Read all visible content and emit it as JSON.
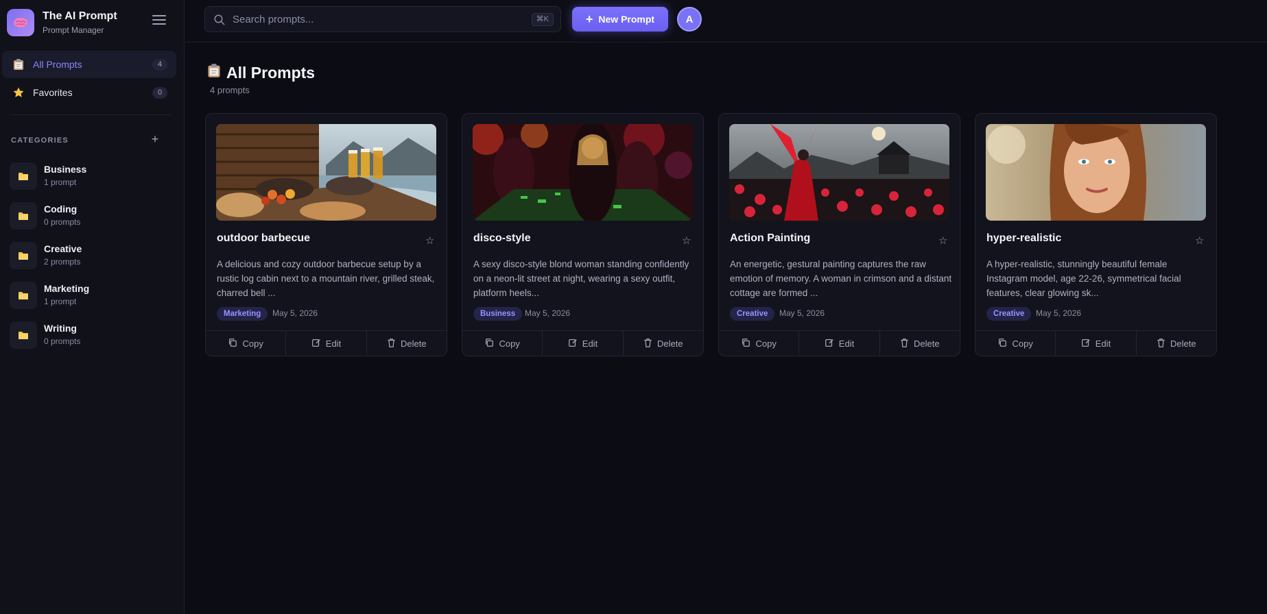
{
  "app": {
    "title": "The AI Prompt",
    "subtitle": "Prompt Manager"
  },
  "nav": [
    {
      "label": "All Prompts",
      "count": "4",
      "icon": "clipboard-icon",
      "active": true
    },
    {
      "label": "Favorites",
      "count": "0",
      "icon": "star-icon",
      "active": false
    }
  ],
  "categories": {
    "heading": "CATEGORIES",
    "items": [
      {
        "name": "Business",
        "count": "1 prompt"
      },
      {
        "name": "Coding",
        "count": "0 prompts"
      },
      {
        "name": "Creative",
        "count": "2 prompts"
      },
      {
        "name": "Marketing",
        "count": "1 prompt"
      },
      {
        "name": "Writing",
        "count": "0 prompts"
      }
    ]
  },
  "search": {
    "placeholder": "Search prompts...",
    "shortcut": "⌘K"
  },
  "toolbar": {
    "new_label": "New Prompt",
    "avatar_initial": "A"
  },
  "main": {
    "title": "All Prompts",
    "count_label": "4 prompts"
  },
  "cards": [
    {
      "title": "outdoor barbecue",
      "description": "A delicious and cozy outdoor barbecue setup by a rustic log cabin next to a mountain river, grilled steak, charred bell ...",
      "tag": "Marketing",
      "date": "May 5, 2026"
    },
    {
      "title": "disco-style",
      "description": "A sexy disco-style blond woman standing confidently on a neon-lit street at night, wearing a sexy outfit, platform heels...",
      "tag": "Business",
      "date": "May 5, 2026"
    },
    {
      "title": "Action Painting",
      "description": "An energetic, gestural painting captures the raw emotion of memory. A woman in crimson and a distant cottage are formed ...",
      "tag": "Creative",
      "date": "May 5, 2026"
    },
    {
      "title": "hyper-realistic",
      "description": "A hyper-realistic, stunningly beautiful female Instagram model, age 22-26, symmetrical facial features, clear glowing sk...",
      "tag": "Creative",
      "date": "May 5, 2026"
    }
  ],
  "actions": {
    "copy": "Copy",
    "edit": "Edit",
    "delete": "Delete"
  },
  "colors": {
    "accent": "#7b71fb",
    "background": "#0c0d14",
    "sidebar": "#101119",
    "folder": "#f5c542"
  }
}
